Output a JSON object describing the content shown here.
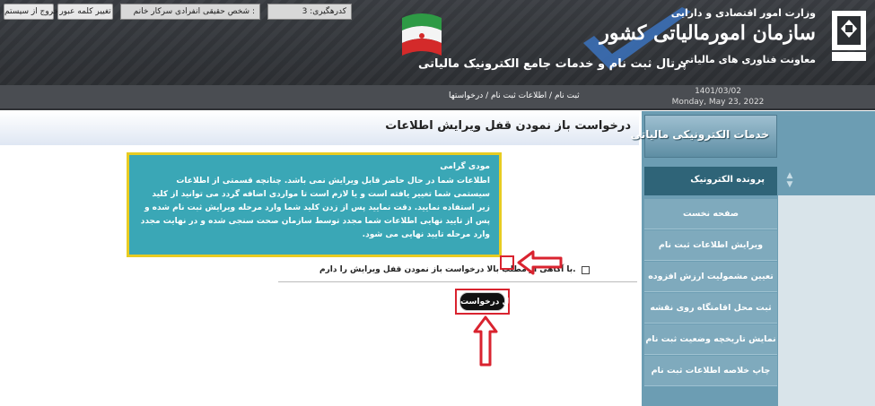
{
  "header": {
    "org_small": "وزارت امور اقتصادی و دارایی",
    "org_title": "سازمان امورمالیاتی کشور",
    "org_sub": "معاونت فناوری های مالیاتی",
    "portal_title": "پرتال ثبت نام و خدمات جامع الکترونیک مالیاتی"
  },
  "topbar": {
    "exit_label": "خروج از سیستم",
    "change_password_label": "تغییر کلمه عبور",
    "user_name": "شخص حقیقی انفرادی سرکار خانم :",
    "tracking_code": "کدرهگیری: 3",
    "breadcrumb": "ثبت نام / اطلاعات ثبت نام / درخواستها",
    "date_jalali": "1401/03/02",
    "date_gregorian": "Monday, May 23, 2022"
  },
  "main": {
    "page_title": "درخواست باز نمودن قفل ویرایش اطلاعات",
    "notice_greeting": "مودی گرامی",
    "notice_body": "اطلاعات شما در حال حاضر قابل ویرایش نمی باشد. چنانچه قسمتی از اطلاعات سیستمی شما تغییر یافته است و یا لازم است تا مواردی اضافه گردد می توانید از کلید زیر استفاده نمایید. دقت نمایید پس از زدن کلید شما وارد مرحله ویرایش ثبت نام شده و پس از تایید نهایی اطلاعات شما مجدد توسط سازمان صحت سنجی شده و در نهایت مجدد وارد مرحله تایید نهایی می شود.",
    "agree_text": "با آگاهی از مطلب بالا درخواست باز نمودن قفل ویرایش را دارم.",
    "submit_label": "ارسال درخواست"
  },
  "sidebar": {
    "banner": "خدمات الکترونیکی مالیاتی",
    "section": "پرونده الکترونیک",
    "items": [
      "صفحه نخست",
      "ویرایش اطلاعات ثبت نام",
      "تعیین مشمولیت ارزش افزوده",
      "ثبت محل اقامتگاه روی نقشه",
      "نمایش تاریخچه وضعیت ثبت نام",
      "چاپ خلاصه اطلاعات ثبت نام"
    ]
  },
  "colors": {
    "header_bg": "#2c2f33",
    "notice_bg": "#3aa7b6",
    "notice_border": "#e8cc21",
    "highlight_red": "#d9232f",
    "sidebar_bg": "#6c9db3"
  }
}
